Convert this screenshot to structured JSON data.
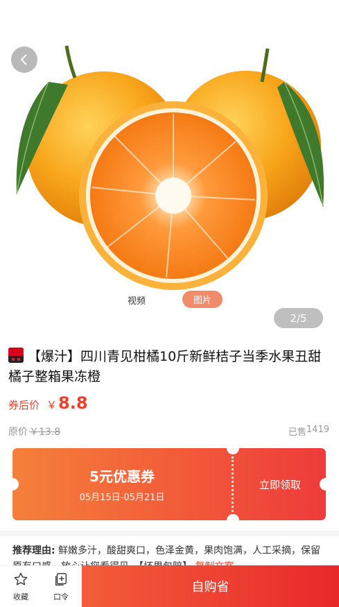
{
  "gallery": {
    "tab_video": "视频",
    "tab_photo": "图片",
    "page_indicator": "2/5"
  },
  "product": {
    "title": "【爆汁】四川青见柑橘10斤新鲜桔子当季水果丑甜橘子整箱果冻橙",
    "price_label": "券后价",
    "price_symbol": "￥",
    "price": "8.8",
    "original_label": "原价",
    "original_price": "￥13.8",
    "sold_label": "已售",
    "sold_count": "1419"
  },
  "coupon": {
    "title": "5元优惠券",
    "date_range": "05月15日-05月21日",
    "action": "立即领取"
  },
  "reason": {
    "label": "推荐理由:",
    "text": " 鲜嫩多汁，酸甜爽口，色泽金黄，果肉饱满，人工采摘，保留原有口感，放心让您看得见。",
    "tag": "【坏果包赔】",
    "copy": "复制文案"
  },
  "bottom_bar": {
    "favorite_label": "收藏",
    "code_label": "口令",
    "buy_label": "自购省"
  },
  "colors": {
    "accent": "#e8422e",
    "coupon_start": "#f5803a",
    "coupon_end": "#ee3b3b"
  }
}
